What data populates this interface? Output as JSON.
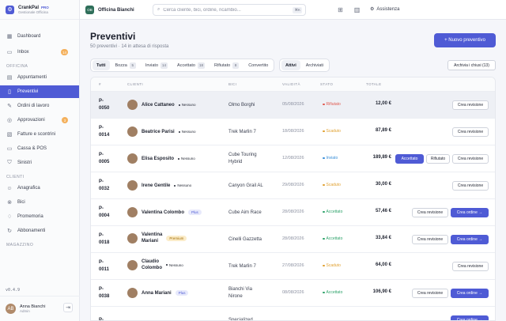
{
  "brand": {
    "name": "CrankPal",
    "pro": "PRO",
    "subtitle": "Gestionale Officina",
    "logo_icon": "bike-icon"
  },
  "topbar": {
    "shop_name": "Officina Bianchi",
    "shop_logo": "OB",
    "search_placeholder": "Cerca cliente, bici, ordine, ricambio...",
    "search_shortcut": "⌘K",
    "assist_label": "Assistenza"
  },
  "sidebar": {
    "items": [
      {
        "label": "Dashboard",
        "icon": "grid-icon"
      },
      {
        "label": "Inbox",
        "icon": "inbox-icon",
        "badge": "14"
      }
    ],
    "section_officina": "OFFICINA",
    "officina_items": [
      {
        "label": "Appuntamenti",
        "icon": "calendar-icon"
      },
      {
        "label": "Preventivi",
        "icon": "document-icon",
        "active": true
      },
      {
        "label": "Ordini di lavoro",
        "icon": "wrench-icon"
      },
      {
        "label": "Approvazioni",
        "icon": "check-circle-icon",
        "badge": "3"
      },
      {
        "label": "Fatture e scontrini",
        "icon": "receipt-icon"
      },
      {
        "label": "Cassa & POS",
        "icon": "card-icon"
      },
      {
        "label": "Sinistri",
        "icon": "shield-icon"
      }
    ],
    "section_clienti": "CLIENTI",
    "clienti_items": [
      {
        "label": "Anagrafica",
        "icon": "users-icon"
      },
      {
        "label": "Bici",
        "icon": "bike-icon"
      },
      {
        "label": "Promemoria",
        "icon": "bell-icon"
      },
      {
        "label": "Abbonamenti",
        "icon": "refresh-icon"
      }
    ],
    "section_magazzino": "MAGAZZINO",
    "version": "v0.4.9",
    "user": {
      "name": "Anna Bianchi",
      "role": "Admin",
      "initials": "AB"
    }
  },
  "main": {
    "title": "Preventivi",
    "subtitle": "50 preventivi · 14 in attesa di risposta",
    "new_button": "+ Nuovo preventivo",
    "tabs": [
      {
        "label": "Tutti",
        "active": true
      },
      {
        "label": "Bozza",
        "count": "5"
      },
      {
        "label": "Inviato",
        "count": "14"
      },
      {
        "label": "Accettato",
        "count": "18"
      },
      {
        "label": "Rifiutato",
        "count": "8"
      },
      {
        "label": "Convertito"
      }
    ],
    "view_tabs": [
      {
        "label": "Attivi",
        "active": true
      },
      {
        "label": "Archiviati"
      }
    ],
    "archive_button": "Archivia i chiusi (13)",
    "columns": [
      "#",
      "CLIENTI",
      "BICI",
      "VALIDITÀ",
      "STATO",
      "TOTALE"
    ]
  },
  "rows": [
    {
      "id": "P-\n0050",
      "customer": "Alice Cattaneo",
      "tag": "Nessuno",
      "tag_type": "none",
      "bike": "Olmo Borghi",
      "date": "05/08/2026",
      "status": "Rifiutato",
      "status_color": "#e05a4f",
      "total": "12,00 €",
      "actions": [
        "Crea revisione"
      ],
      "highlight": true
    },
    {
      "id": "P-\n0014",
      "customer": "Beatrice Parisi",
      "tag": "Nessuno",
      "tag_type": "none",
      "bike": "Trek Marlin 7",
      "date": "18/08/2026",
      "status": "Scaduto",
      "status_color": "#e0a030",
      "total": "87,89 €",
      "actions": [
        "Crea revisione"
      ]
    },
    {
      "id": "P-\n0005",
      "customer": "Elisa Esposito",
      "tag": "Nessuno",
      "tag_type": "none",
      "bike": "Cube Touring\nHybrid",
      "date": "12/08/2026",
      "status": "Inviato",
      "status_color": "#3a8fd8",
      "total": "189,89 €",
      "actions": [
        "Accettato",
        "Rifiutato",
        "Crea revisione"
      ]
    },
    {
      "id": "P-\n0032",
      "customer": "Irene Gentile",
      "tag": "Nessuno",
      "tag_type": "none",
      "bike": "Canyon Grail AL",
      "date": "29/08/2026",
      "status": "Scaduto",
      "status_color": "#e0a030",
      "total": "30,00 €",
      "actions": [
        "Crea revisione"
      ]
    },
    {
      "id": "P-\n0004",
      "customer": "Valentina Colombo",
      "tag": "Plus",
      "tag_type": "plus",
      "bike": "Cube Aim Race",
      "date": "28/08/2026",
      "status": "Accettato",
      "status_color": "#2fa36b",
      "total": "57,46 €",
      "actions": [
        "Crea revisione",
        "Crea ordine →"
      ]
    },
    {
      "id": "P-\n0018",
      "customer": "Valentina\nMariani",
      "tag": "Premium",
      "tag_type": "prem",
      "bike": "Cinelli Gazzetta",
      "date": "28/08/2026",
      "status": "Accettato",
      "status_color": "#2fa36b",
      "total": "33,84 €",
      "actions": [
        "Crea revisione",
        "Crea ordine →"
      ]
    },
    {
      "id": "P-\n0011",
      "customer": "Claudio\nColombo",
      "tag": "Nessuno",
      "tag_type": "none",
      "bike": "Trek Marlin 7",
      "date": "27/08/2026",
      "status": "Scaduto",
      "status_color": "#e0a030",
      "total": "64,00 €",
      "actions": [
        "Crea revisione"
      ]
    },
    {
      "id": "P-\n0038",
      "customer": "Anna Mariani",
      "tag": "Plus",
      "tag_type": "plus",
      "bike": "Bianchi Via\nNirone",
      "date": "08/08/2026",
      "status": "Accettato",
      "status_color": "#2fa36b",
      "total": "106,90 €",
      "actions": [
        "Crea revisione",
        "Crea ordine →"
      ]
    },
    {
      "id": "P-",
      "customer": "",
      "tag": "",
      "tag_type": "none",
      "bike": "Specialized",
      "date": "",
      "status": "",
      "status_color": "#2fa36b",
      "total": "",
      "actions": [
        "Crea ordine →"
      ]
    }
  ]
}
